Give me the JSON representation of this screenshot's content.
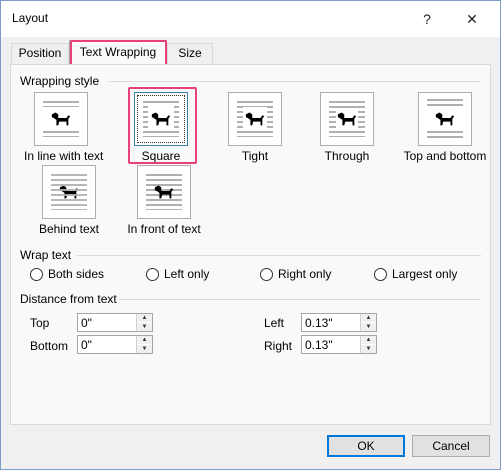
{
  "window": {
    "title": "Layout",
    "help": "?",
    "close": "✕"
  },
  "tabs": [
    {
      "label": "Position"
    },
    {
      "label": "Text Wrapping"
    },
    {
      "label": "Size"
    }
  ],
  "wrapping_style": {
    "label": "Wrapping style",
    "options": [
      {
        "label": "In line with text"
      },
      {
        "label": "Square"
      },
      {
        "label": "Tight"
      },
      {
        "label": "Through"
      },
      {
        "label": "Top and bottom"
      },
      {
        "label": "Behind text"
      },
      {
        "label": "In front of text"
      }
    ],
    "selected": "Square"
  },
  "wrap_text": {
    "label": "Wrap text",
    "options": [
      {
        "label": "Both sides"
      },
      {
        "label": "Left only"
      },
      {
        "label": "Right only"
      },
      {
        "label": "Largest only"
      }
    ]
  },
  "distance": {
    "label": "Distance from text",
    "top": {
      "label": "Top",
      "value": "0\""
    },
    "bottom": {
      "label": "Bottom",
      "value": "0\""
    },
    "left": {
      "label": "Left",
      "value": "0.13\""
    },
    "right": {
      "label": "Right",
      "value": "0.13\""
    }
  },
  "buttons": {
    "ok": "OK",
    "cancel": "Cancel"
  },
  "colors": {
    "highlight": "#e8407a",
    "accent": "#0078d7"
  }
}
